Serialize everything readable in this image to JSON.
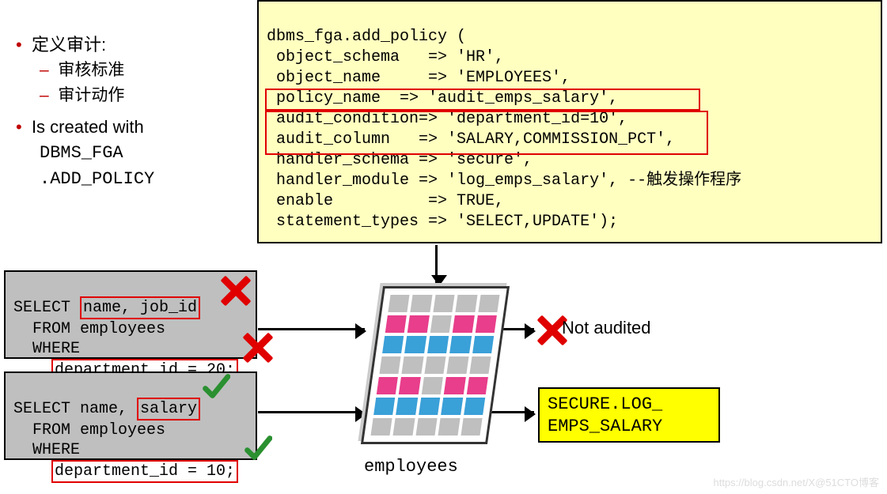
{
  "bullets": {
    "item1": "定义审计:",
    "item1a": "审核标准",
    "item1b": "审计动作",
    "item2": "Is created with",
    "item2a": "DBMS_FGA",
    "item2b": ".ADD_POLICY"
  },
  "code": {
    "line1": "dbms_fga.add_policy (",
    "line2": " object_schema   => 'HR',",
    "line3": " object_name     => 'EMPLOYEES',",
    "line4": " policy_name  => 'audit_emps_salary',",
    "line5": " audit_condition=> 'department_id=10',",
    "line6": " audit_column   => 'SALARY,COMMISSION_PCT',",
    "line7": " handler_schema => 'secure',",
    "line8": " handler_module => 'log_emps_salary', --触发操作程序",
    "line9": " enable          => TRUE,",
    "line10": " statement_types => 'SELECT,UPDATE');"
  },
  "sql1": {
    "l1a": "SELECT ",
    "l1b": "name, job_id",
    "l2": "  FROM employees",
    "l3": "  WHERE",
    "l4a": "    ",
    "l4b": "department_id = 20;"
  },
  "sql2": {
    "l1a": "SELECT name, ",
    "l1b": "salary",
    "l2": "  FROM employees",
    "l3": "  WHERE",
    "l4a": "    ",
    "l4b": "department_id = 10;"
  },
  "tableLabel": "employees",
  "notAuditedLabel": "Not audited",
  "secureBox": {
    "l1": "SECURE.LOG_",
    "l2": "EMPS_SALARY"
  },
  "watermark": "https://blog.csdn.net/X@51CTO博客"
}
